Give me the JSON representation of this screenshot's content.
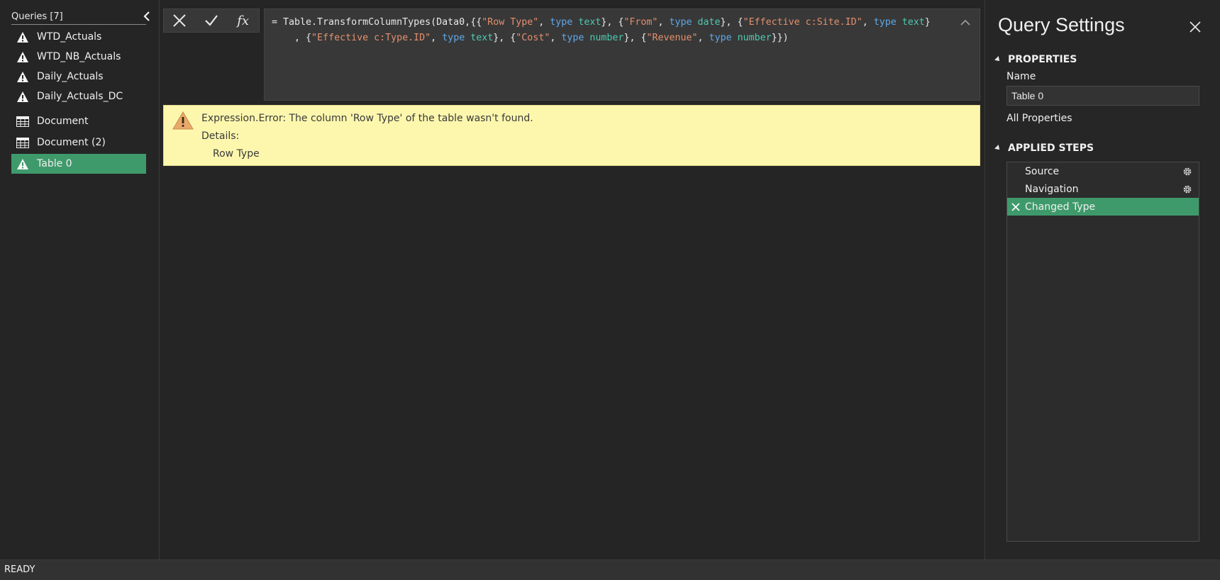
{
  "queries": {
    "header": "Queries [7]",
    "items": [
      {
        "label": "WTD_Actuals",
        "icon": "warning-icon"
      },
      {
        "label": "WTD_NB_Actuals",
        "icon": "warning-icon"
      },
      {
        "label": "Daily_Actuals",
        "icon": "warning-icon"
      },
      {
        "label": "Daily_Actuals_DC",
        "icon": "warning-icon"
      },
      {
        "label": "Document",
        "icon": "table-icon"
      },
      {
        "label": "Document (2)",
        "icon": "table-icon"
      },
      {
        "label": "Table 0",
        "icon": "warning-icon",
        "selected": true
      }
    ]
  },
  "formula": {
    "fx_label": "fx",
    "line1": {
      "prefix": "= Table.TransformColumnTypes(Data0,{{",
      "s1": "\"Row Type\"",
      "k1": "type",
      "t1": "text",
      "mid1": "}, {",
      "s2": "\"From\"",
      "k2": "type",
      "t2": "date",
      "mid2": "}, {",
      "s3": "\"Effective c:Site.ID\"",
      "k3": "type",
      "t3": "text",
      "end": "}"
    },
    "line2": {
      "prefix": "    , {",
      "s4": "\"Effective c:Type.ID\"",
      "k4": "type",
      "t4": "text",
      "mid4": "}, {",
      "s5": "\"Cost\"",
      "k5": "type",
      "t5": "number",
      "mid5": "}, {",
      "s6": "\"Revenue\"",
      "k6": "type",
      "t6": "number",
      "end": "}})"
    }
  },
  "error": {
    "message": "Expression.Error: The column 'Row Type' of the table wasn't found.",
    "details_label": "Details:",
    "details_value": "Row Type"
  },
  "settings": {
    "title": "Query Settings",
    "properties_heading": "PROPERTIES",
    "name_label": "Name",
    "name_value": "Table 0",
    "all_properties": "All Properties",
    "applied_steps_heading": "APPLIED STEPS",
    "steps": [
      {
        "label": "Source",
        "has_gear": true
      },
      {
        "label": "Navigation",
        "has_gear": true
      },
      {
        "label": "Changed Type",
        "selected": true,
        "has_delete": true
      }
    ]
  },
  "status": {
    "text": "READY"
  },
  "colors": {
    "accent": "#3f9a6b",
    "error_bg": "#fdf7ad",
    "string": "#e48f6d",
    "keyword": "#5fa8e8",
    "type": "#4ec9b0"
  }
}
